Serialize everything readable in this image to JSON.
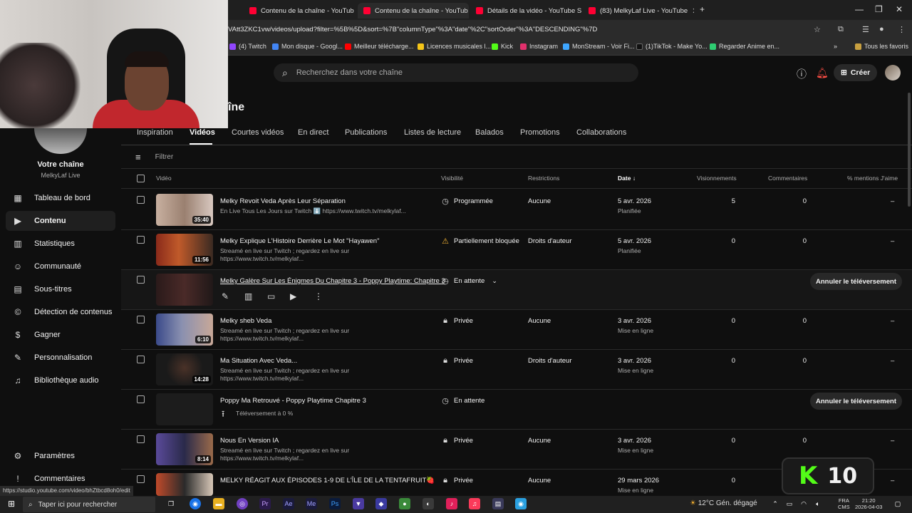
{
  "browser": {
    "tabs": [
      {
        "label": "Contenu de la chaîne - YouTub"
      },
      {
        "label": "Contenu de la chaîne - YouTub"
      },
      {
        "label": "Détails de la vidéo - YouTube S"
      },
      {
        "label": "(83) MelkyLaf Live - YouTube"
      }
    ],
    "url": "VAtt3ZKC1vw/videos/upload?filter=%5B%5D&sort=%7B\"columnType\"%3A\"date\"%2C\"sortOrder\"%3A\"DESCENDING\"%7D",
    "bookmarks": [
      {
        "label": "(4) Twitch",
        "color": "#9146ff"
      },
      {
        "label": "Mon disque - Googl...",
        "color": "#4285f4"
      },
      {
        "label": "Meilleur télécharge...",
        "color": "#ff0000"
      },
      {
        "label": "Licences musicales l...",
        "color": "#f5c518"
      },
      {
        "label": "Kick",
        "color": "#53fc18"
      },
      {
        "label": "Instagram",
        "color": "#e1306c"
      },
      {
        "label": "MonStream - Voir Fi...",
        "color": "#3ea6ff"
      },
      {
        "label": "(1)TikTok - Make Yo...",
        "color": "#000000"
      },
      {
        "label": "Regarder Anime en...",
        "color": "#2ecc71"
      }
    ],
    "favorites_label": "Tous les favoris",
    "status_url": "https://studio.youtube.com/video/bhZtbcd8oh0/edit"
  },
  "header": {
    "search_placeholder": "Recherchez dans votre chaîne",
    "create_label": "Créer",
    "page_title_partial": "îne"
  },
  "sidebar": {
    "channel_name": "Votre chaîne",
    "channel_handle": "MelkyLaf Live",
    "items": [
      {
        "label": "Tableau de bord",
        "icon": "dashboard-icon",
        "glyph": "▦"
      },
      {
        "label": "Contenu",
        "icon": "content-icon",
        "glyph": "▶",
        "active": true
      },
      {
        "label": "Statistiques",
        "icon": "analytics-icon",
        "glyph": "▥"
      },
      {
        "label": "Communauté",
        "icon": "community-icon",
        "glyph": "☺"
      },
      {
        "label": "Sous-titres",
        "icon": "subtitles-icon",
        "glyph": "▤"
      },
      {
        "label": "Détection de contenus",
        "icon": "copyright-icon",
        "glyph": "©"
      },
      {
        "label": "Gagner",
        "icon": "earn-icon",
        "glyph": "$"
      },
      {
        "label": "Personnalisation",
        "icon": "customization-icon",
        "glyph": "✎"
      },
      {
        "label": "Bibliothèque audio",
        "icon": "audio-library-icon",
        "glyph": "♫"
      }
    ],
    "bottom_items": [
      {
        "label": "Paramètres",
        "icon": "settings-icon",
        "glyph": "⚙"
      },
      {
        "label": "Commentaires",
        "icon": "feedback-icon",
        "glyph": "!"
      }
    ]
  },
  "content_tabs": [
    "Inspiration",
    "Vidéos",
    "Courtes vidéos",
    "En direct",
    "Publications",
    "Listes de lecture",
    "Balados",
    "Promotions",
    "Collaborations"
  ],
  "filter_placeholder": "Filtrer",
  "table": {
    "headers": {
      "video": "Vidéo",
      "visibility": "Visibilité",
      "restrictions": "Restrictions",
      "date": "Date",
      "views": "Visionnements",
      "comments": "Commentaires",
      "likes": "% mentions J'aime"
    },
    "rows": [
      {
        "title": "Melky Revoit Veda Après Leur Séparation",
        "desc": "En Live Tous Les Jours sur Twitch ⬇️ https://www.twitch.tv/melkylaf...",
        "duration": "35:40",
        "visibility": "Programmée",
        "vis_icon": "clock",
        "restrictions": "Aucune",
        "date": "5 avr. 2026",
        "date_sub": "Planifiée",
        "views": "5",
        "comments": "0",
        "likes": "–",
        "thumb": "#b8a088"
      },
      {
        "title": "Melky Explique L'Histoire Derrière Le Mot \"Hayawen\"",
        "desc": "Streamé en live sur Twitch ; regardez en live sur https://www.twitch.tv/melkylaf...",
        "duration": "11:56",
        "visibility": "Partiellement bloquée",
        "vis_icon": "warning",
        "restrictions": "Droits d'auteur",
        "date": "5 avr. 2026",
        "date_sub": "Planifiée",
        "views": "0",
        "comments": "0",
        "likes": "–",
        "thumb": "#7a3a2a"
      },
      {
        "title": "Melky Galère Sur Les Énigmes Du Chapitre 3 - Poppy Playtime: Chapitre 3",
        "desc": "",
        "duration": "",
        "visibility": "En attente",
        "vis_icon": "clock",
        "restrictions": "",
        "date": "",
        "date_sub": "",
        "views": "",
        "comments": "",
        "likes": "",
        "cancel": "Annuler le téléversement",
        "thumb": "#3a2424"
      },
      {
        "title": "Melky sheb Veda",
        "desc": "Streamé en live sur Twitch ; regardez en live sur https://www.twitch.tv/melkylaf...",
        "duration": "6:10",
        "visibility": "Privée",
        "vis_icon": "lock",
        "restrictions": "Aucune",
        "date": "3 avr. 2026",
        "date_sub": "Mise en ligne",
        "views": "0",
        "comments": "0",
        "likes": "–",
        "thumb": "#5a6a9a"
      },
      {
        "title": "Ma Situation Avec Veda...",
        "desc": "Streamé en live sur Twitch ; regardez en live sur https://www.twitch.tv/melkylaf...",
        "duration": "14:28",
        "visibility": "Privée",
        "vis_icon": "lock",
        "restrictions": "Droits d'auteur",
        "date": "3 avr. 2026",
        "date_sub": "Mise en ligne",
        "views": "0",
        "comments": "0",
        "likes": "–",
        "thumb": "#2a2a2a"
      },
      {
        "title": "Poppy Ma Retrouvé - Poppy Playtime Chapitre 3",
        "desc": "Téléversement à 0 %",
        "duration": "",
        "visibility": "En attente",
        "vis_icon": "clock",
        "restrictions": "",
        "date": "",
        "date_sub": "",
        "views": "",
        "comments": "",
        "likes": "",
        "cancel": "Annuler le téléversement",
        "thumb": "#1c1c1c"
      },
      {
        "title": "Nous En Version IA",
        "desc": "Streamé en live sur Twitch ; regardez en live sur https://www.twitch.tv/melkylaf...",
        "duration": "8:14",
        "visibility": "Privée",
        "vis_icon": "lock",
        "restrictions": "Aucune",
        "date": "3 avr. 2026",
        "date_sub": "Mise en ligne",
        "views": "0",
        "comments": "0",
        "likes": "–",
        "thumb": "#5a4a8a"
      },
      {
        "title": "MELKY RÉAGIT AUX ÉPISODES 1-9 DE L'ÎLE DE LA TENTAFRUIT🍓",
        "desc": "",
        "duration": "",
        "visibility": "Privée",
        "vis_icon": "lock",
        "restrictions": "Aucune",
        "date": "29 mars 2026",
        "date_sub": "Mise en ligne",
        "views": "0",
        "comments": "0",
        "likes": "–",
        "thumb": "#8a3a2a"
      }
    ]
  },
  "overlay": {
    "k_letter": "K",
    "k_number": "10"
  },
  "taskbar": {
    "search_placeholder": "Taper ici pour rechercher",
    "weather": "12°C  Gén. dégagé",
    "lang": "FRA",
    "lang_sub": "CMS",
    "time": "21:20",
    "date": "2026-04-03"
  }
}
